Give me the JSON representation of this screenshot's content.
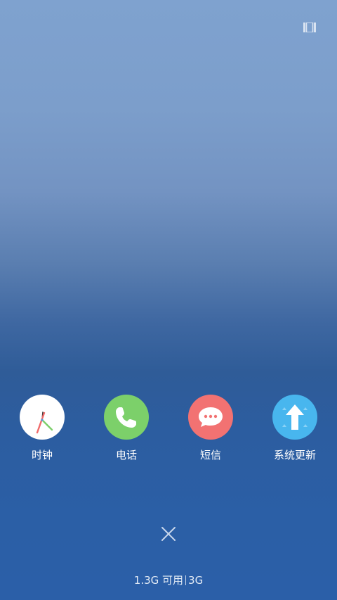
{
  "status_bar": {
    "icon": "recents-grid-icon"
  },
  "apps": [
    {
      "label": "时钟",
      "icon": "clock-icon",
      "color": "#ffffff"
    },
    {
      "label": "电话",
      "icon": "phone-icon",
      "color": "#7cd06a"
    },
    {
      "label": "短信",
      "icon": "message-icon",
      "color": "#f27272"
    },
    {
      "label": "系统更新",
      "icon": "system-update-icon",
      "color": "#48b6ee"
    }
  ],
  "close_icon": "close-icon",
  "memory": {
    "available": "1.3G 可用",
    "network": "3G"
  }
}
